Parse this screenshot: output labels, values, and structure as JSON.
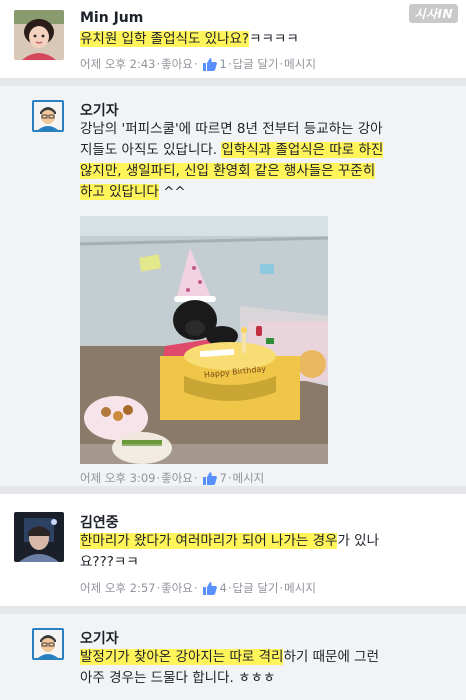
{
  "watermark": "시사IN",
  "comments": [
    {
      "author": "Min Jum",
      "lines": [
        {
          "hl": "유치원 입학 졸업식도 있나요?",
          "rest": "ㅋㅋㅋㅋ"
        }
      ],
      "meta": {
        "time": "어제 오후 2:43",
        "like": "좋아요",
        "likes": "1",
        "reply": "답글 달기",
        "message": "메시지"
      }
    },
    {
      "author": "오기자",
      "lines": [
        {
          "pre": "강남의 '퍼피스쿨'에 따르면 8년 전부터 등교하는 강아",
          "hl": ""
        },
        {
          "pre": "지들도 아직도 있답니다.  ",
          "hl": "입학식과 졸업식은 따로 하진"
        },
        {
          "pre": "",
          "hl": "않지만, 생일파티, 신입 환영회 같은 행사들은 꾸준히"
        },
        {
          "pre": "",
          "hl": "하고 있답니다",
          "rest": " ^^"
        }
      ],
      "photo_alt": "birthday party photo with dog and cake",
      "cake_text": "Happy Birthday",
      "meta": {
        "time": "어제 오후 3:09",
        "like": "좋아요",
        "likes": "7",
        "message": "메시지"
      }
    },
    {
      "author": "김연중",
      "lines": [
        {
          "hl": "한마리가 왔다가 여러마리가 되어 나가는 경우",
          "rest": "가 있나"
        },
        {
          "pre": "요???ㅋㅋ"
        }
      ],
      "meta": {
        "time": "어제 오후 2:57",
        "like": "좋아요",
        "likes": "4",
        "reply": "답글 달기",
        "message": "메시지"
      }
    },
    {
      "author": "오기자",
      "lines": [
        {
          "hl": "발정기가 찾아온 강아지는 따로 격리",
          "rest": "하기 때문에 그런"
        },
        {
          "pre": "아주 경우는 드물다 합니다. ㅎㅎㅎ"
        }
      ]
    }
  ]
}
